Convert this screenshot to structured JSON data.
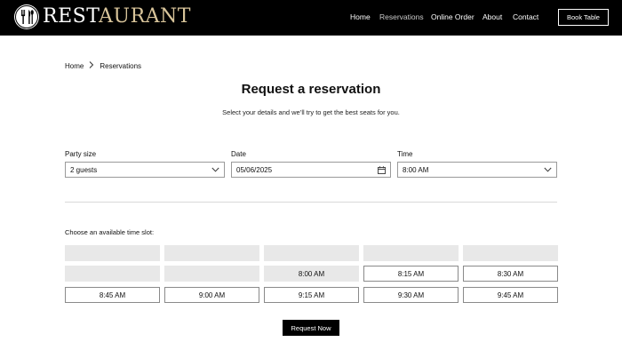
{
  "brand": {
    "name_part1": "REST",
    "name_part2": "AURANT"
  },
  "nav": {
    "items": [
      {
        "label": "Home",
        "active": false
      },
      {
        "label": "Reservations",
        "active": true
      },
      {
        "label": "Online Order",
        "active": false
      },
      {
        "label": "About",
        "active": false
      },
      {
        "label": "Contact",
        "active": false
      }
    ],
    "cta_label": "Book Table"
  },
  "breadcrumb": {
    "home": "Home",
    "current": "Reservations"
  },
  "page": {
    "title": "Request a reservation",
    "subtitle": "Select your details and we’ll try to get the best seats for you."
  },
  "form": {
    "party_size": {
      "label": "Party size",
      "value": "2 guests"
    },
    "date": {
      "label": "Date",
      "value": "05/06/2025"
    },
    "time": {
      "label": "Time",
      "value": "8:00 AM"
    }
  },
  "slots": {
    "label": "Choose an available time slot:",
    "rows": [
      [
        {
          "label": "",
          "available": false
        },
        {
          "label": "",
          "available": false
        },
        {
          "label": "",
          "available": false
        },
        {
          "label": "",
          "available": false
        },
        {
          "label": "",
          "available": false
        }
      ],
      [
        {
          "label": "",
          "available": false
        },
        {
          "label": "",
          "available": false
        },
        {
          "label": "8:00 AM",
          "available": false
        },
        {
          "label": "8:15 AM",
          "available": true
        },
        {
          "label": "8:30 AM",
          "available": true
        }
      ],
      [
        {
          "label": "8:45 AM",
          "available": true
        },
        {
          "label": "9:00 AM",
          "available": true
        },
        {
          "label": "9:15 AM",
          "available": true
        },
        {
          "label": "9:30 AM",
          "available": true
        },
        {
          "label": "9:45 AM",
          "available": true
        }
      ]
    ]
  },
  "submit_label": "Request Now",
  "colors": {
    "header_bg": "#000000",
    "brand_gold": "#d8c49a",
    "slot_unavailable": "#e8e8e8"
  }
}
